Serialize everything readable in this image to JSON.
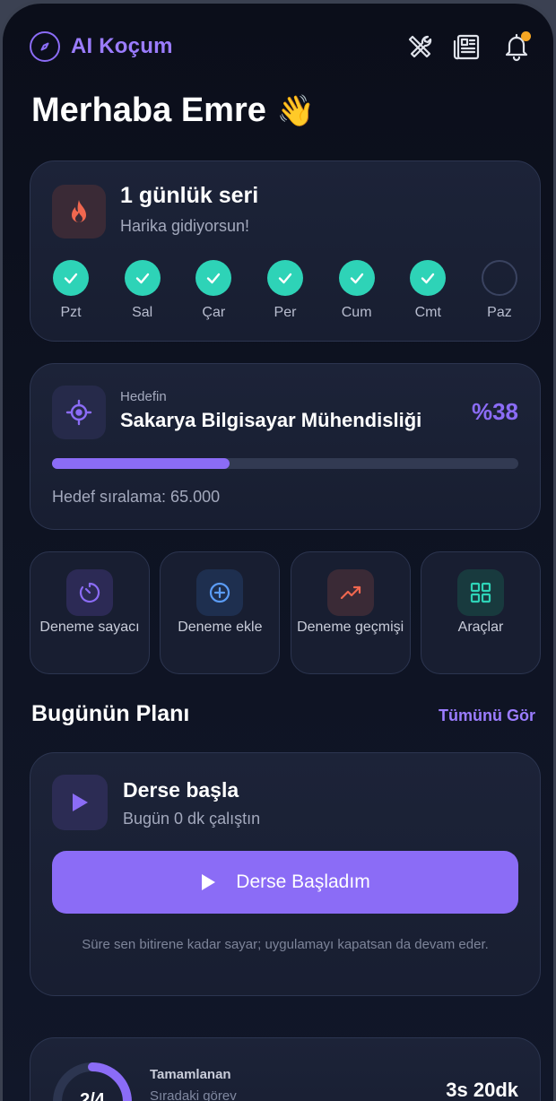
{
  "header": {
    "app_name": "AI Koçum",
    "brand_icon": "compass-icon",
    "actions": [
      "tools-icon",
      "news-icon",
      "bell-icon"
    ],
    "has_notification": true
  },
  "greeting": {
    "text": "Merhaba Emre",
    "emoji": "👋"
  },
  "streak": {
    "title": "1 günlük seri",
    "subtitle": "Harika gidiyorsun!",
    "days": [
      {
        "label": "Pzt",
        "done": true
      },
      {
        "label": "Sal",
        "done": true
      },
      {
        "label": "Çar",
        "done": true
      },
      {
        "label": "Per",
        "done": true
      },
      {
        "label": "Cum",
        "done": true
      },
      {
        "label": "Cmt",
        "done": true
      },
      {
        "label": "Paz",
        "done": false
      }
    ]
  },
  "goal": {
    "kicker": "Hedefin",
    "title": "Sakarya Bilgisayar Mühendisliği",
    "percent_label": "%38",
    "progress": 0.38,
    "rank_label": "Hedef sıralama: 65.000"
  },
  "tiles": [
    {
      "id": "deneme-sayaci",
      "label": "Deneme sayacı",
      "icon": "timer-icon"
    },
    {
      "id": "deneme-ekle",
      "label": "Deneme ekle",
      "icon": "plus-circle-icon"
    },
    {
      "id": "deneme-gecmisi",
      "label": "Deneme geçmişi",
      "icon": "trend-up-icon"
    },
    {
      "id": "araclar",
      "label": "Araçlar",
      "icon": "grid-icon"
    }
  ],
  "plan_section": {
    "title": "Bugünün Planı",
    "see_all": "Tümünü Gör"
  },
  "plan": {
    "title": "Derse başla",
    "subtitle": "Bugün 0 dk çalıştın",
    "button": "Derse Başladım",
    "note": "Süre sen bitirene kadar sayar; uygulamayı kapatsan da devam eder."
  },
  "stats": {
    "ring_label": "2/4",
    "progress": 0.5,
    "title": "Tamamlanan",
    "subtitle": "Sıradaki görev",
    "time": "3s 20dk"
  },
  "colors": {
    "accent": "#8b6cf6",
    "check": "#2ed3b7",
    "flame": "#f0674f",
    "notification": "#f6a623"
  }
}
